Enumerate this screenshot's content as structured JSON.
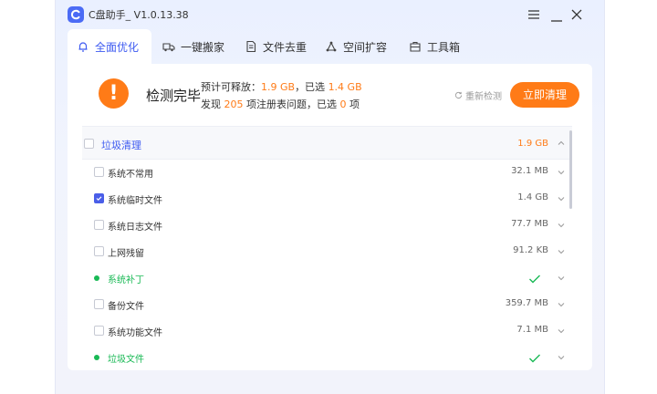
{
  "app": {
    "title": "C盘助手_ V1.0.13.38"
  },
  "tabs": [
    {
      "label": "全面优化"
    },
    {
      "label": "一键搬家"
    },
    {
      "label": "文件去重"
    },
    {
      "label": "空间扩容"
    },
    {
      "label": "工具箱"
    }
  ],
  "summary": {
    "title": "检测完毕",
    "l1_prefix": "预计可释放：",
    "l1_release": "1.9 GB",
    "l1_mid": "，已选",
    "l1_selected": "1.4 GB",
    "l2_prefix": "发现",
    "l2_found": "205",
    "l2_mid": "项注册表问题，已选",
    "l2_selected": "0",
    "l2_suffix": "项",
    "rescan_label": "重新检测",
    "clean_label": "立即清理"
  },
  "list": {
    "header": {
      "label": "垃圾清理",
      "size": "1.9 GB"
    },
    "items": [
      {
        "label": "系统不常用",
        "size": "32.1 MB",
        "checked": false,
        "kind": "checkbox"
      },
      {
        "label": "系统临时文件",
        "size": "1.4 GB",
        "checked": true,
        "kind": "checkbox"
      },
      {
        "label": "系统日志文件",
        "size": "77.7 MB",
        "checked": false,
        "kind": "checkbox"
      },
      {
        "label": "上网残留",
        "size": "91.2 KB",
        "checked": false,
        "kind": "checkbox"
      },
      {
        "label": "系统补丁",
        "size": "",
        "checked": false,
        "kind": "ok"
      },
      {
        "label": "备份文件",
        "size": "359.7 MB",
        "checked": false,
        "kind": "checkbox"
      },
      {
        "label": "系统功能文件",
        "size": "7.1 MB",
        "checked": false,
        "kind": "checkbox"
      },
      {
        "label": "垃圾文件",
        "size": "",
        "checked": false,
        "kind": "ok"
      }
    ]
  },
  "colors": {
    "accent": "#3d5af1",
    "orange": "#ff7b17",
    "green": "#19b955"
  }
}
